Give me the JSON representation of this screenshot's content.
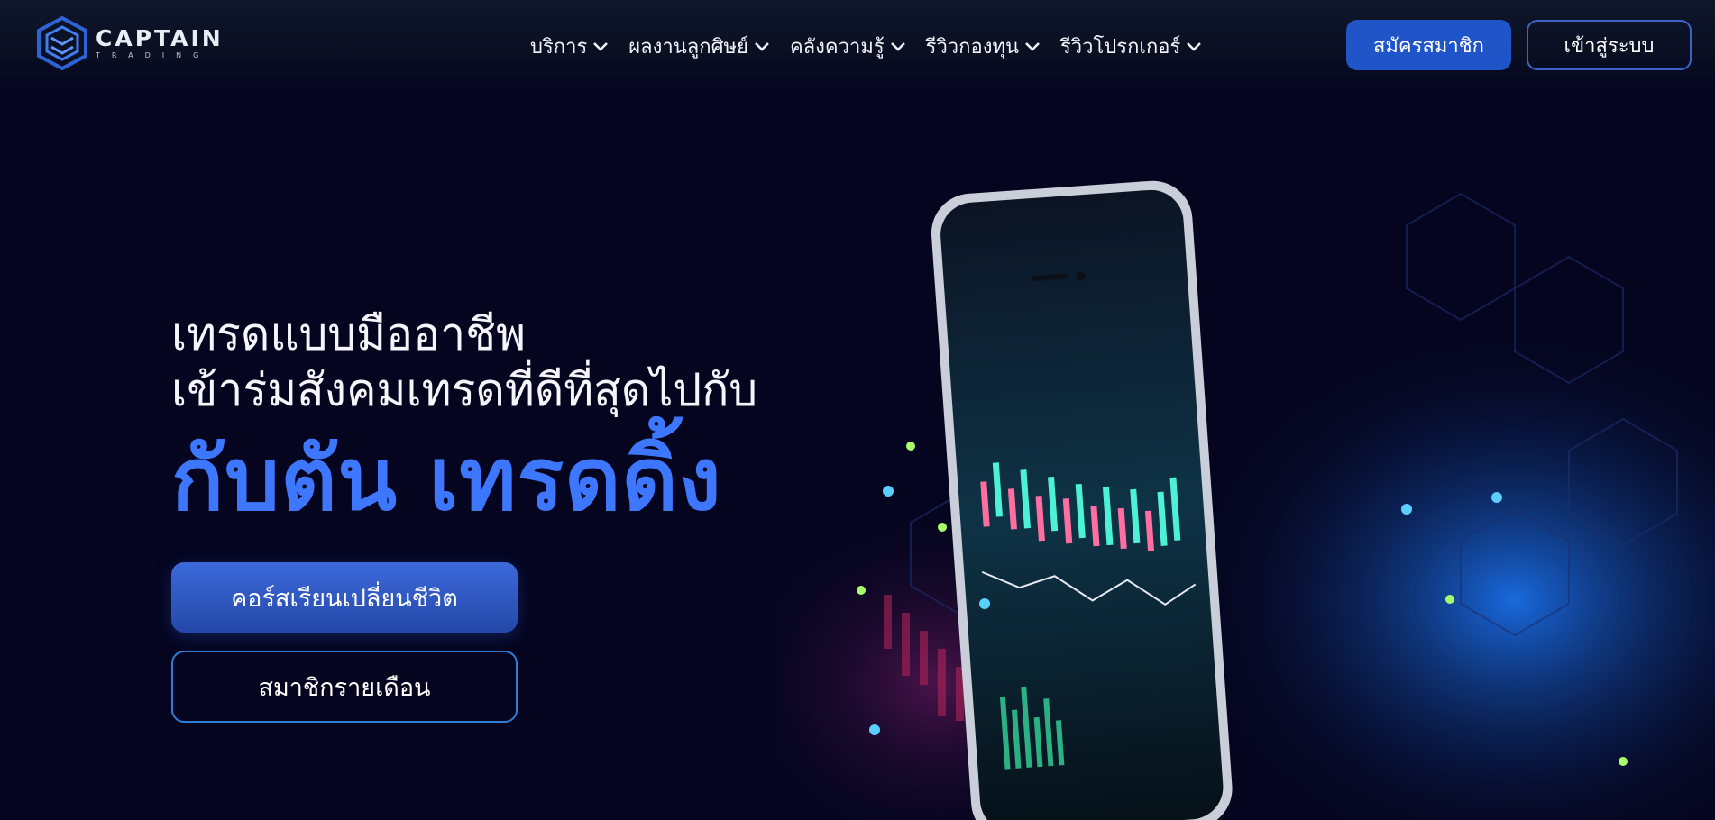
{
  "header": {
    "logo": {
      "word": "CAPTAIN",
      "sub": "TRADING"
    },
    "nav": [
      {
        "label": "บริการ",
        "icon": "chevron-down-icon"
      },
      {
        "label": "ผลงานลูกศิษย์",
        "icon": "chevron-down-icon"
      },
      {
        "label": "คลังความรู้",
        "icon": "chevron-down-icon"
      },
      {
        "label": "รีวิวกองทุน",
        "icon": "chevron-down-icon"
      },
      {
        "label": "รีวิวโปรกเกอร์",
        "icon": "chevron-down-icon"
      }
    ],
    "register_label": "สมัครสมาชิก",
    "login_label": "เข้าสู่ระบบ"
  },
  "hero": {
    "line1": "เทรดแบบมืออาชีพ",
    "line2": "เข้าร่มสังคมเทรดที่ดีที่สุดไปกับ",
    "brand": "กับตัน เทรดดิ้ง",
    "course_button": "คอร์สเรียนเปลี่ยนชีวิต",
    "member_button": "สมาชิกรายเดือน"
  },
  "colors": {
    "background": "#05051f",
    "accent": "#3d76ff",
    "button_primary": "#1f55c8",
    "button_outline": "#2c7ed8"
  }
}
